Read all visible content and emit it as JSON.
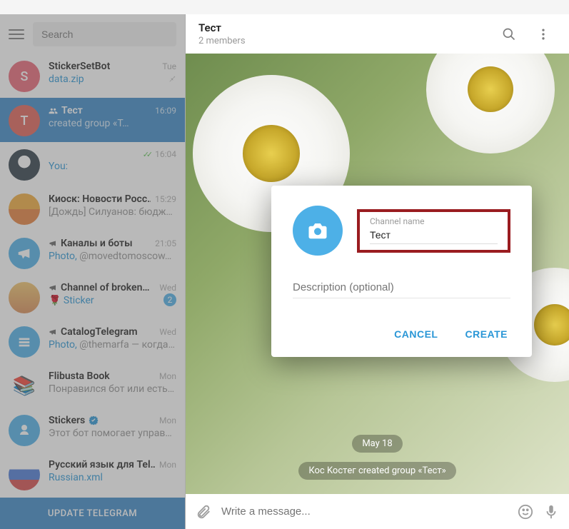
{
  "search": {
    "placeholder": "Search"
  },
  "header": {
    "title": "Тест",
    "subtitle": "2 members"
  },
  "chats": [
    {
      "name": "StickerSetBot",
      "time": "Tue",
      "preview": "data.zip",
      "preview_link": true,
      "avatar_letter": "S",
      "avatar_bg": "#e96476",
      "pinned": true
    },
    {
      "name": "Тест",
      "time": "16:09",
      "preview": "created group «Т…",
      "avatar_letter": "T",
      "avatar_bg": "#e05f54",
      "group": true,
      "active": true
    },
    {
      "name": "",
      "time": "16:04",
      "you_prefix": "You:",
      "preview": "",
      "checks": true,
      "avatar_bg": "#2d3b46"
    },
    {
      "name": "Киоск: Новости Росс…",
      "time": "15:29",
      "preview": "[Дождь]  Силуанов: бюджет…",
      "avatar_bg": "#f0a93a"
    },
    {
      "name": "Каналы и боты",
      "time": "21:05",
      "preview_prefix": "Photo,",
      "preview": " @movedtomoscow…",
      "mega": true,
      "avatar_bg": "#4db0e7"
    },
    {
      "name": "Channel of broken…",
      "time": "Wed",
      "preview_prefix": "🌹 ",
      "preview": "Sticker",
      "preview_link": true,
      "mega": true,
      "badge": "2",
      "avatar_bg": "#d88b55"
    },
    {
      "name": "CatalogTelegram",
      "time": "Wed",
      "preview_prefix": "Photo,",
      "preview": " @themarfa — когда …",
      "mega": true,
      "avatar_bg": "#4db0e7"
    },
    {
      "name": "Flibusta Book",
      "time": "Mon",
      "preview": "Понравился бот или есть п…",
      "avatar_bg": "#2e2e2e"
    },
    {
      "name": "Stickers",
      "time": "Mon",
      "preview": "Этот бот помогает управля…",
      "verified": true,
      "avatar_bg": "#4db0e7"
    },
    {
      "name": "Русский язык для Tel…",
      "time": "Mon",
      "preview": "Russian.xml",
      "preview_link": true,
      "avatar_bg": "#e8e8e8"
    }
  ],
  "update_bar": "UPDATE TELEGRAM",
  "chat_area": {
    "date_pill": "May 18",
    "system_msg": "Кос Koстeг created group «Тест»"
  },
  "composer": {
    "placeholder": "Write a message..."
  },
  "modal": {
    "channel_name_label": "Channel name",
    "channel_name_value": "Тест",
    "description_placeholder": "Description (optional)",
    "cancel": "CANCEL",
    "create": "CREATE"
  }
}
